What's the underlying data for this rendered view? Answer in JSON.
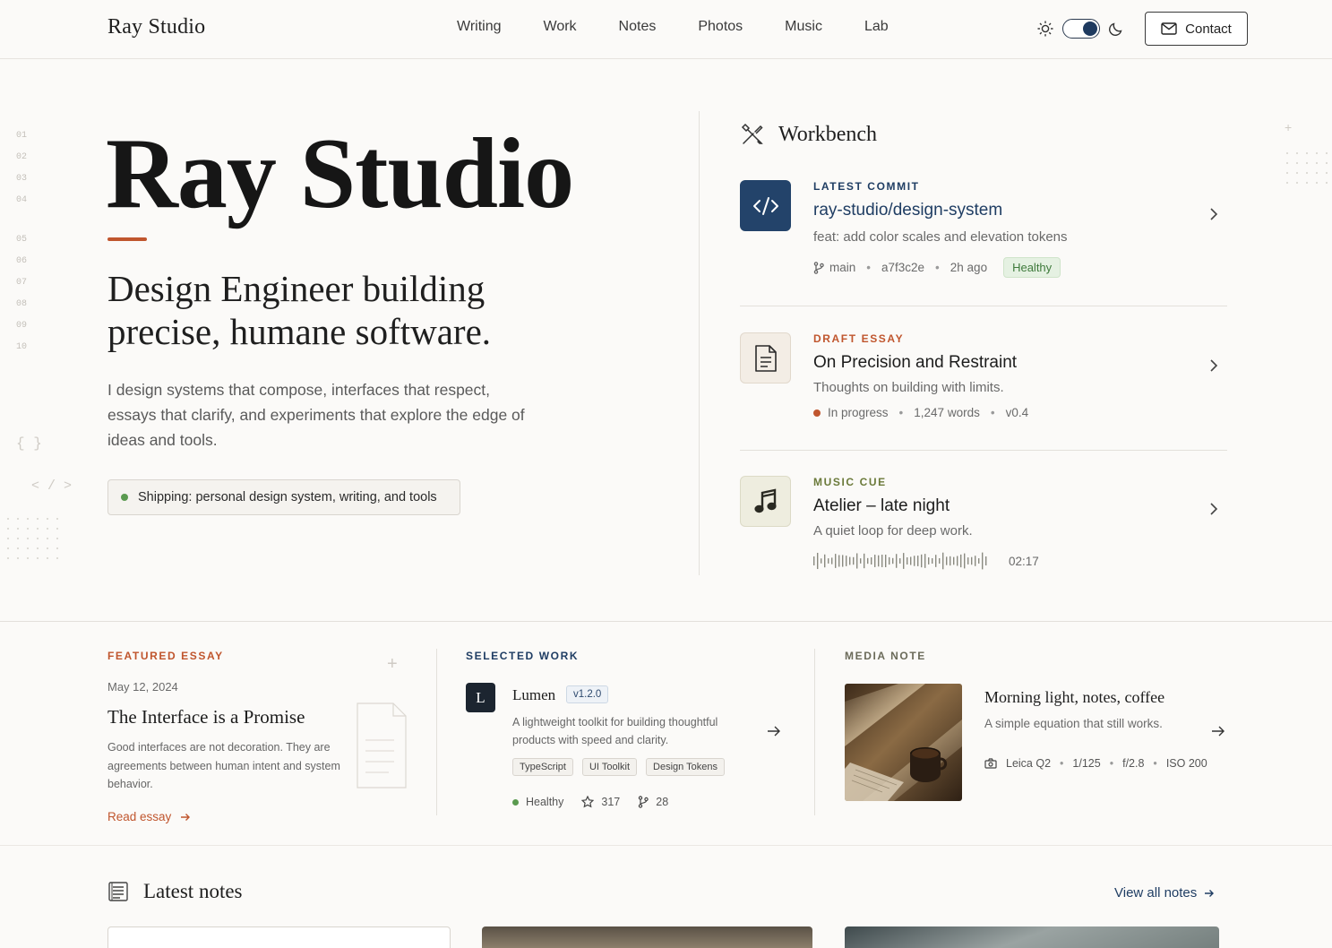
{
  "brand": "Ray Studio",
  "nav": {
    "links": [
      "Writing",
      "Work",
      "Notes",
      "Photos",
      "Music",
      "Lab"
    ],
    "contact_label": "Contact"
  },
  "gutter": {
    "numbers_top": [
      "01",
      "02",
      "03",
      "04"
    ],
    "numbers_bottom": [
      "05",
      "06",
      "07",
      "08",
      "09",
      "10"
    ],
    "brace": "{ }",
    "tag": "< / >"
  },
  "hero": {
    "title": "Ray Studio",
    "subtitle": "Design Engineer building precise, humane software.",
    "description": "I design systems that compose, interfaces that respect, essays that clarify, and experiments that explore the edge of ideas and tools.",
    "status": "Shipping: personal design system, writing, and tools"
  },
  "workbench": {
    "title": "Workbench",
    "items": [
      {
        "kicker": "LATEST COMMIT",
        "title": "ray-studio/design-system",
        "desc": "feat: add color scales and elevation tokens",
        "branch": "main",
        "hash": "a7f3c2e",
        "time": "2h ago",
        "badge": "Healthy"
      },
      {
        "kicker": "DRAFT ESSAY",
        "title": "On Precision and Restraint",
        "desc": "Thoughts on building with limits.",
        "status": "In progress",
        "words": "1,247 words",
        "version": "v0.4"
      },
      {
        "kicker": "MUSIC CUE",
        "title": "Atelier – late night",
        "desc": "A quiet loop for deep work.",
        "duration": "02:17"
      }
    ]
  },
  "featured_essay": {
    "kicker": "FEATURED ESSAY",
    "date": "May 12, 2024",
    "title": "The Interface is a Promise",
    "body": "Good interfaces are not decoration. They are agreements between human intent and system behavior.",
    "link": "Read essay"
  },
  "selected_work": {
    "kicker": "SELECTED WORK",
    "logo_letter": "L",
    "name": "Lumen",
    "version": "v1.2.0",
    "desc": "A lightweight toolkit for building thoughtful products with speed and clarity.",
    "tags": [
      "TypeScript",
      "UI Toolkit",
      "Design Tokens"
    ],
    "status": "Healthy",
    "stars": "317",
    "forks": "28"
  },
  "media_note": {
    "kicker": "MEDIA NOTE",
    "title": "Morning light, notes, coffee",
    "sub": "A simple equation that still works.",
    "camera": "Leica Q2",
    "shutter": "1/125",
    "aperture": "f/2.8",
    "iso": "ISO 200"
  },
  "latest_notes": {
    "title": "Latest notes",
    "link": "View all notes"
  },
  "colors": {
    "accent": "#c0562e",
    "navy": "#1f3d63",
    "olive": "#6b7a3a",
    "healthy": "#5a9a4f"
  }
}
